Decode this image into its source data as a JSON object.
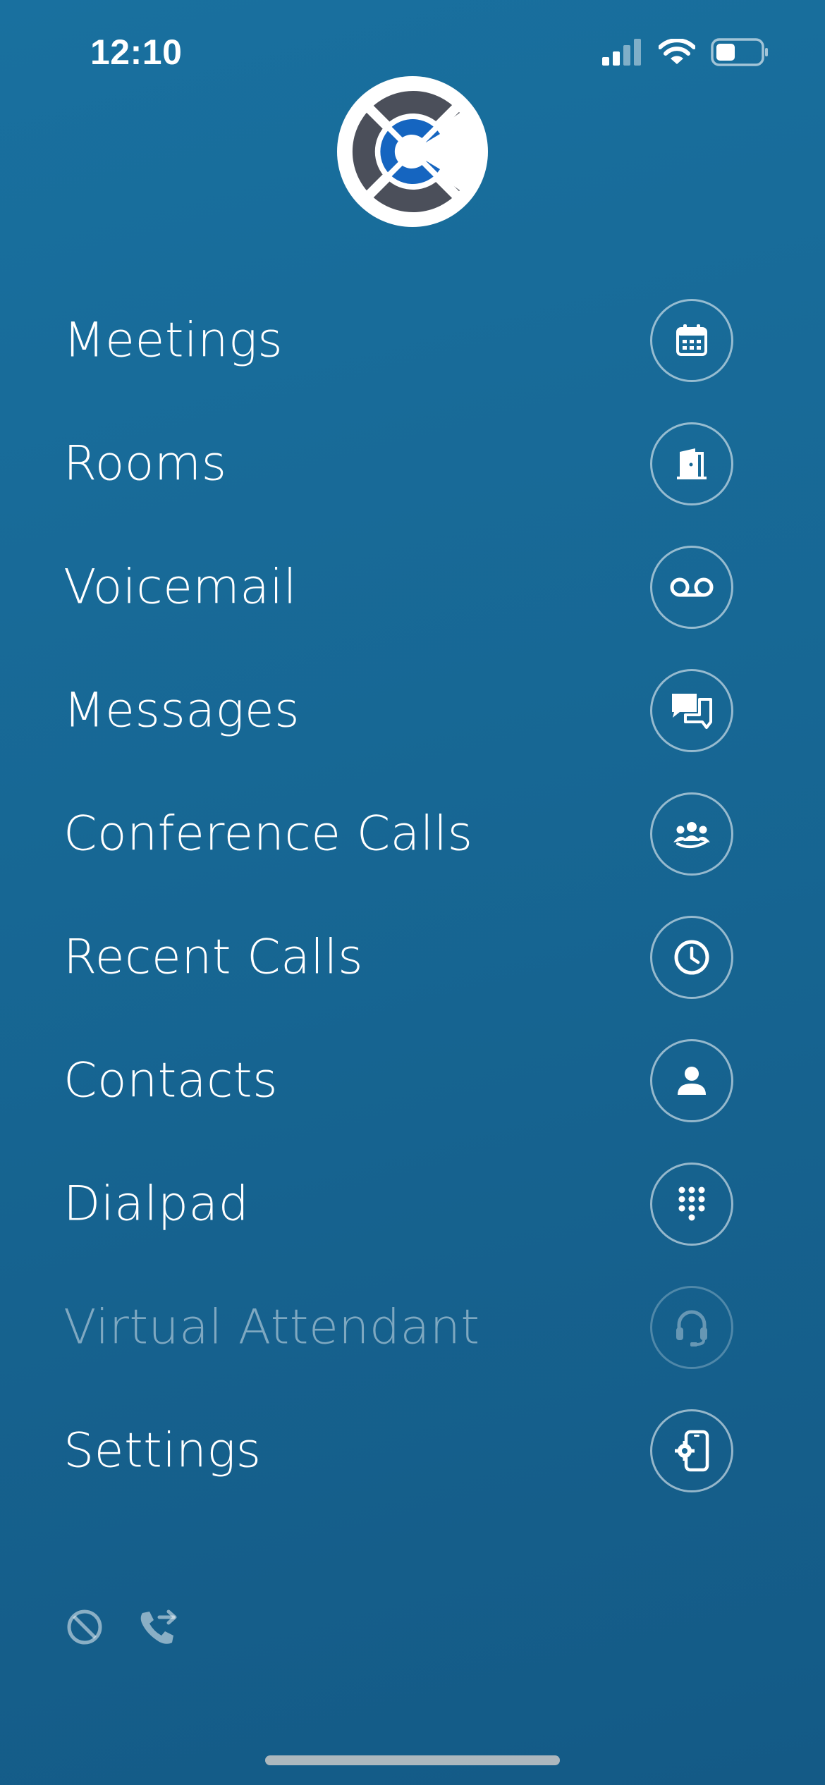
{
  "status_bar": {
    "time": "12:10",
    "icons": [
      "cellular-signal-icon",
      "wifi-icon",
      "battery-icon"
    ]
  },
  "logo": {
    "icon": "app-logo-icon",
    "colors": {
      "dark": "#4b4f5a",
      "accent": "#1565c0",
      "background": "#ffffff"
    }
  },
  "menu": {
    "items": [
      {
        "label": "Meetings",
        "icon": "calendar-icon"
      },
      {
        "label": "Rooms",
        "icon": "door-icon"
      },
      {
        "label": "Voicemail",
        "icon": "voicemail-icon"
      },
      {
        "label": "Messages",
        "icon": "chat-bubbles-icon"
      },
      {
        "label": "Conference Calls",
        "icon": "group-icon"
      },
      {
        "label": "Recent Calls",
        "icon": "clock-icon"
      },
      {
        "label": "Contacts",
        "icon": "person-icon"
      },
      {
        "label": "Dialpad",
        "icon": "dialpad-icon"
      },
      {
        "label": "Virtual Attendant",
        "icon": "headset-icon",
        "disabled": true
      },
      {
        "label": "Settings",
        "icon": "phone-settings-icon"
      }
    ]
  },
  "footer": {
    "icons": [
      "do-not-disturb-icon",
      "call-forward-icon"
    ]
  },
  "colors": {
    "background_top": "#19709f",
    "background_bottom": "#145a86",
    "text": "#ffffff"
  }
}
